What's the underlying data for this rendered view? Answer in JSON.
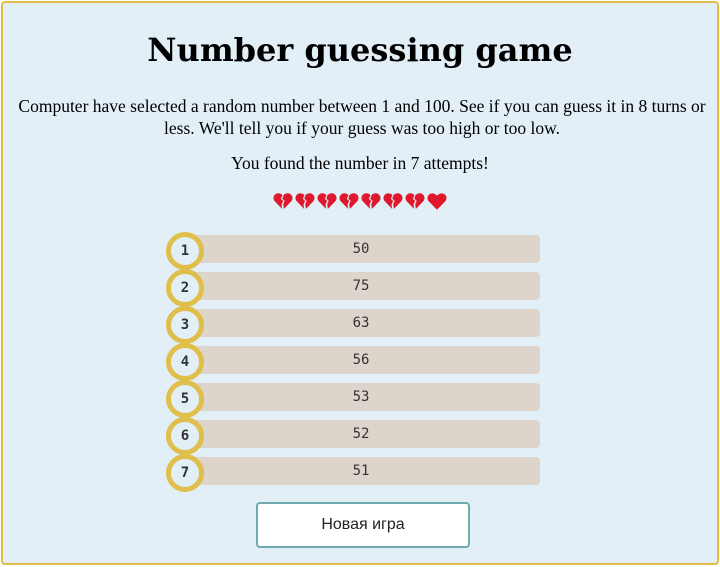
{
  "title": "Number guessing game",
  "intro": "Computer have selected a random number between 1 and 100. See if you can guess it in 8 turns or less. We'll tell you if your guess was too high or too low.",
  "result": "You found the number in 7 attempts!",
  "lives": [
    {
      "icon": "broken-heart-icon"
    },
    {
      "icon": "broken-heart-icon"
    },
    {
      "icon": "broken-heart-icon"
    },
    {
      "icon": "broken-heart-icon"
    },
    {
      "icon": "broken-heart-icon"
    },
    {
      "icon": "broken-heart-icon"
    },
    {
      "icon": "broken-heart-icon"
    },
    {
      "icon": "heart-icon"
    }
  ],
  "attempts": [
    {
      "number": "1",
      "guess": "50"
    },
    {
      "number": "2",
      "guess": "75"
    },
    {
      "number": "3",
      "guess": "63"
    },
    {
      "number": "4",
      "guess": "56"
    },
    {
      "number": "5",
      "guess": "53"
    },
    {
      "number": "6",
      "guess": "52"
    },
    {
      "number": "7",
      "guess": "51"
    }
  ],
  "new_game_label": "Новая игра",
  "colors": {
    "background": "#e2eff7",
    "border": "#e1bd45",
    "bar": "#ddd4cb",
    "badge_ring": "#e0be4a",
    "button_border": "#6faab0",
    "heart": "#e0182d"
  }
}
